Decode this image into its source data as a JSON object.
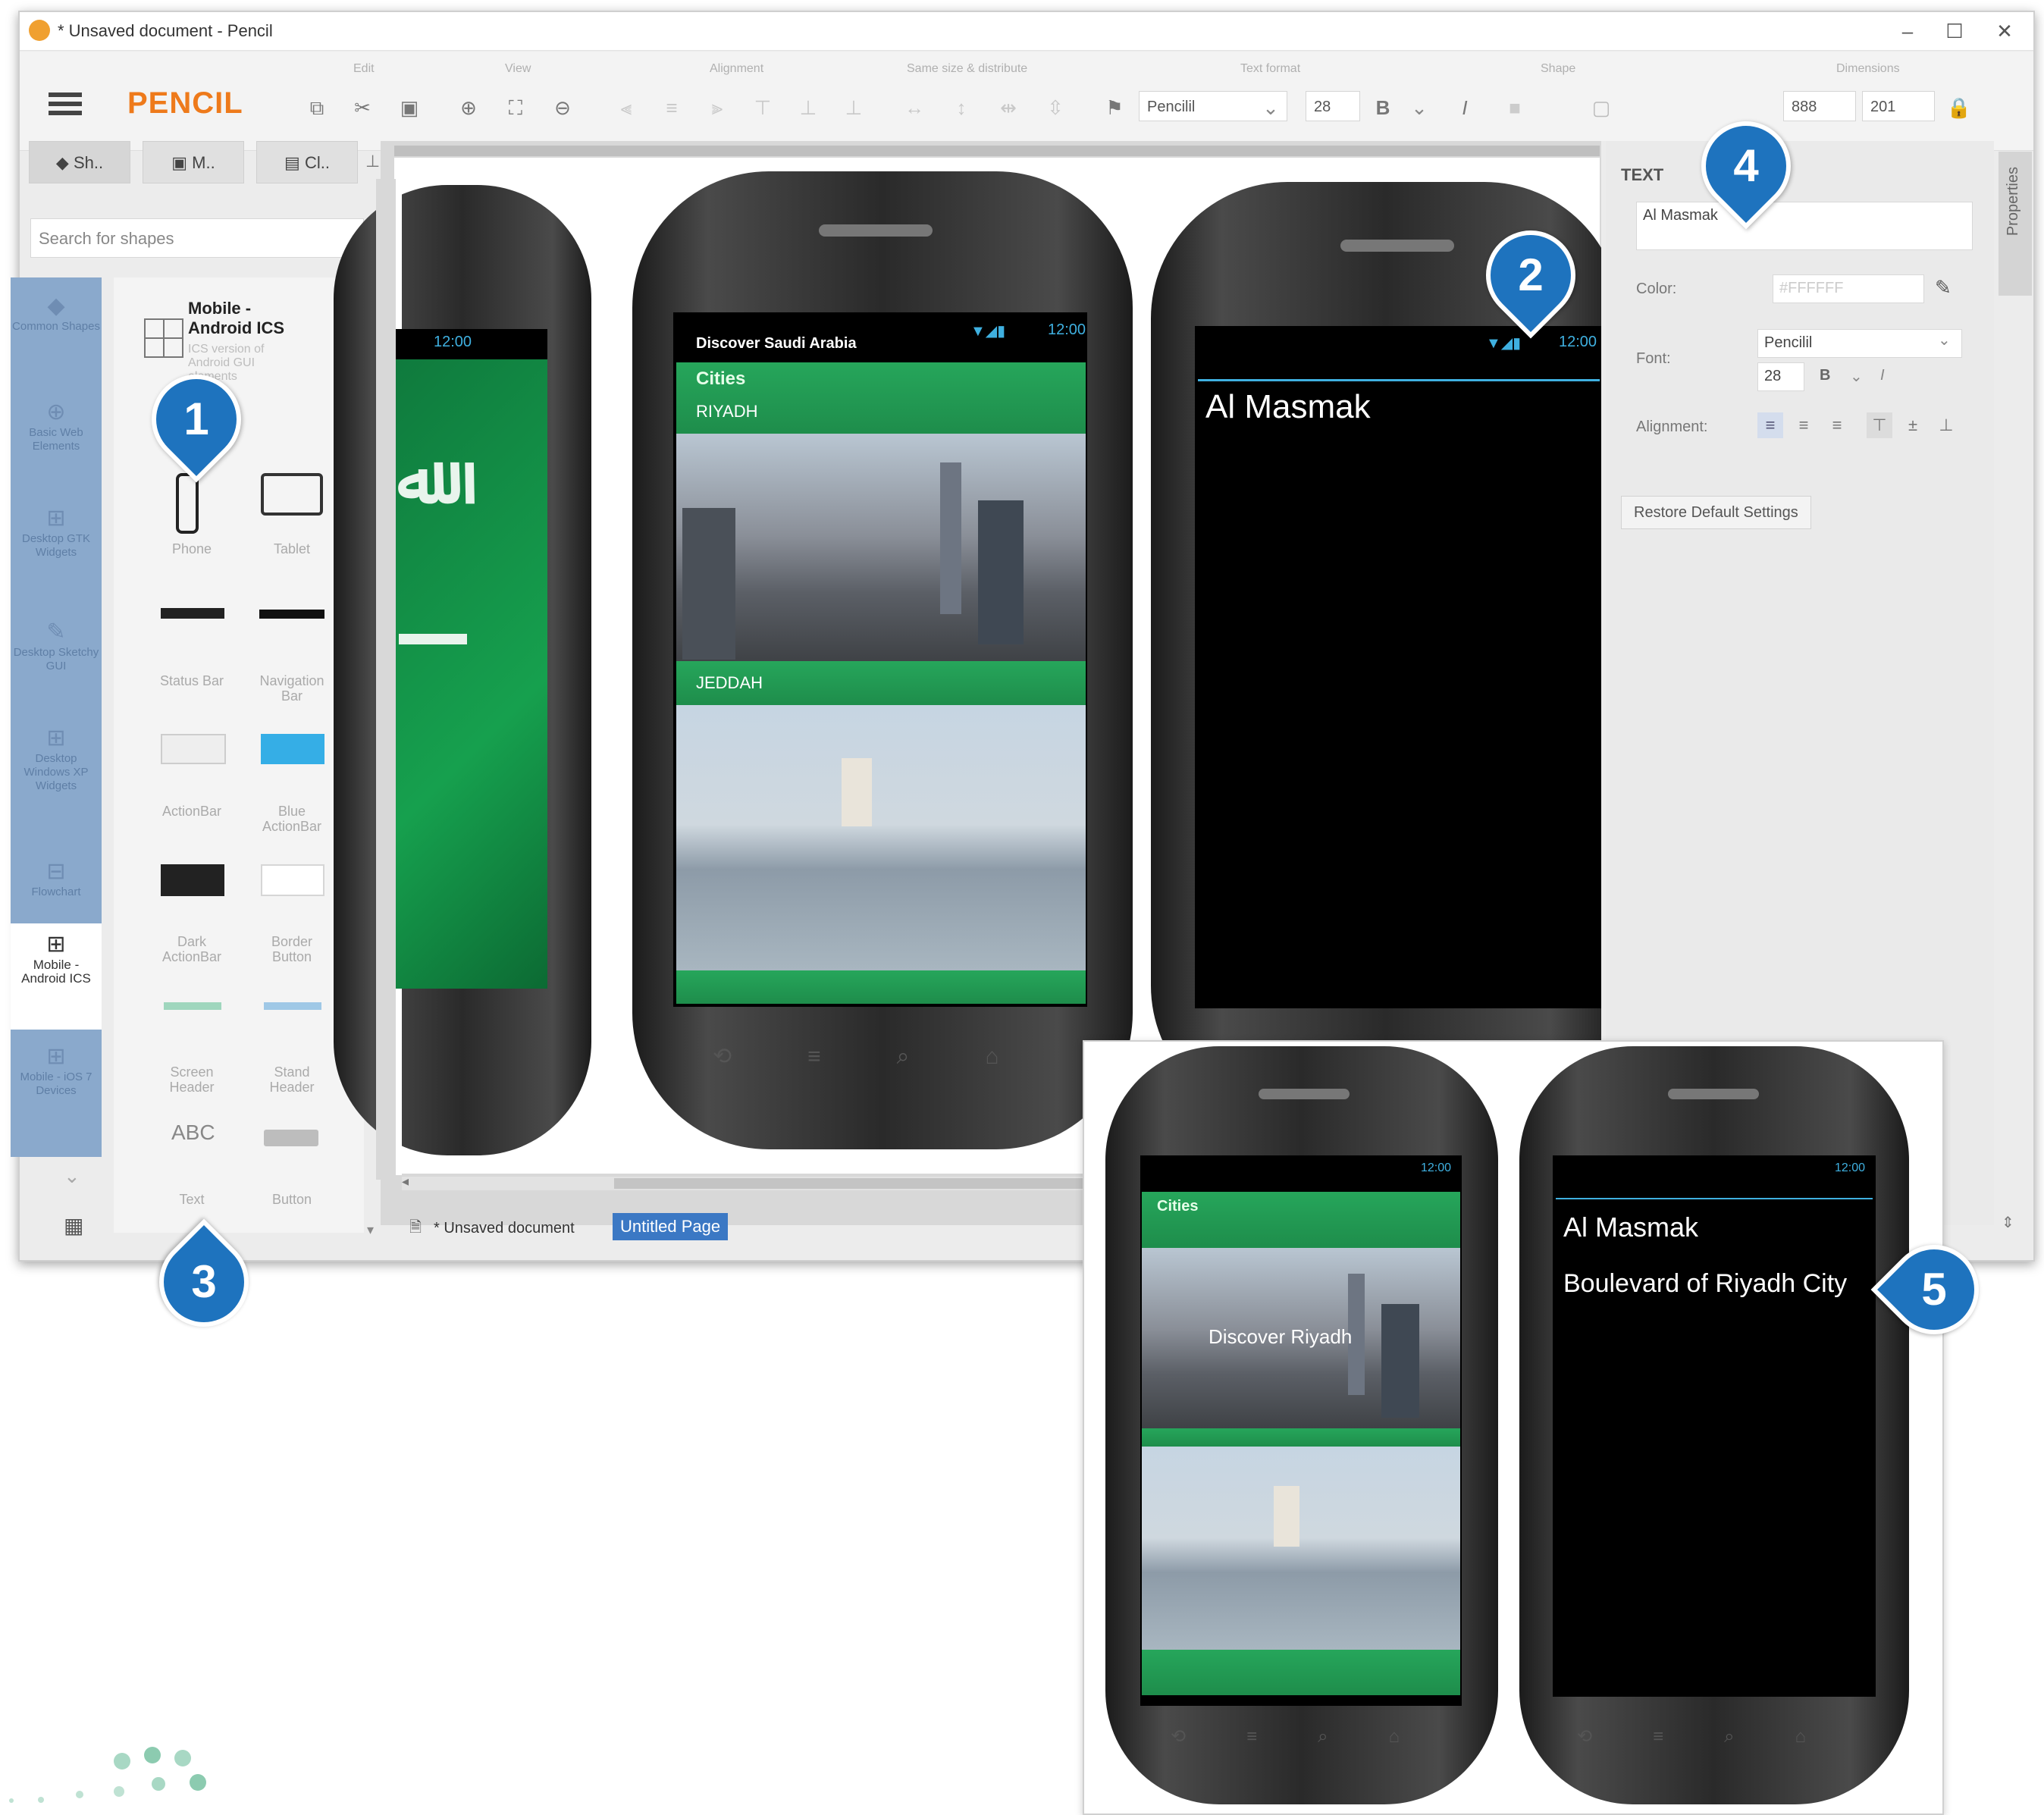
{
  "window": {
    "title": "* Unsaved document - Pencil",
    "brand": "PENCIL",
    "minimize": "–",
    "maximize": "☐",
    "close": "✕"
  },
  "toolbar": {
    "group_labels": [
      "Edit",
      "View",
      "Alignment",
      "Same size & distribute",
      "Text format",
      "Shape",
      "Dimensions"
    ],
    "font_name": "Pencilil",
    "font_size": "28",
    "bold": "B",
    "italic": "I",
    "width": "888",
    "height": "201"
  },
  "left_tabs": [
    "Sh..",
    "M..",
    "Cl.."
  ],
  "search": {
    "placeholder": "Search for shapes"
  },
  "collections": [
    {
      "label": "Common Shapes"
    },
    {
      "label": "Basic Web Elements"
    },
    {
      "label": "Desktop GTK Widgets"
    },
    {
      "label": "Desktop Sketchy GUI"
    },
    {
      "label": "Desktop Windows XP Widgets"
    },
    {
      "label": "Flowchart"
    },
    {
      "label": "Mobile - Android ICS"
    },
    {
      "label": "Mobile - iOS 7 Devices"
    }
  ],
  "selected_collection": {
    "title": "Mobile - Android ICS",
    "subtitle": "ICS version of Android GUI elements"
  },
  "shapes": [
    {
      "label": "Phone"
    },
    {
      "label": "Tablet"
    },
    {
      "label": "Status Bar"
    },
    {
      "label": "Navigation Bar"
    },
    {
      "label": "ActionBar"
    },
    {
      "label": "Blue ActionBar"
    },
    {
      "label": "Dark ActionBar"
    },
    {
      "label": "Border Button"
    },
    {
      "label": "Screen Header"
    },
    {
      "label": "Stand Header"
    },
    {
      "label": "Text"
    },
    {
      "label": "Button"
    }
  ],
  "text_sample": "ABC",
  "canvas": {
    "status_time": "12:00",
    "app_header": "Discover Saudi Arabia",
    "section": "Cities",
    "city1": "RIYADH",
    "city2": "JEDDAH",
    "detail_title": "Al Masmak"
  },
  "bottom": {
    "document_tab": "* Unsaved document",
    "page_tab": "Untitled Page"
  },
  "properties": {
    "section": "TEXT",
    "text_value": "Al Masmak",
    "color_label": "Color:",
    "color_value": "#FFFFFF",
    "font_label": "Font:",
    "font_value": "Pencilil",
    "size_value": "28",
    "alignment_label": "Alignment:",
    "restore_button": "Restore Default Settings",
    "side_tab": "Properties"
  },
  "inset": {
    "status_time": "12:00",
    "section": "Cities",
    "image_caption": "Discover Riyadh",
    "detail_title": "Al Masmak",
    "detail_subtitle": "Boulevard of Riyadh City"
  },
  "callouts": [
    "1",
    "2",
    "3",
    "4",
    "5"
  ],
  "colors": {
    "brand": "#ee7a1b",
    "callout": "#1e73be",
    "green": "#26a65b",
    "selection_blue": "#3b78c4"
  }
}
